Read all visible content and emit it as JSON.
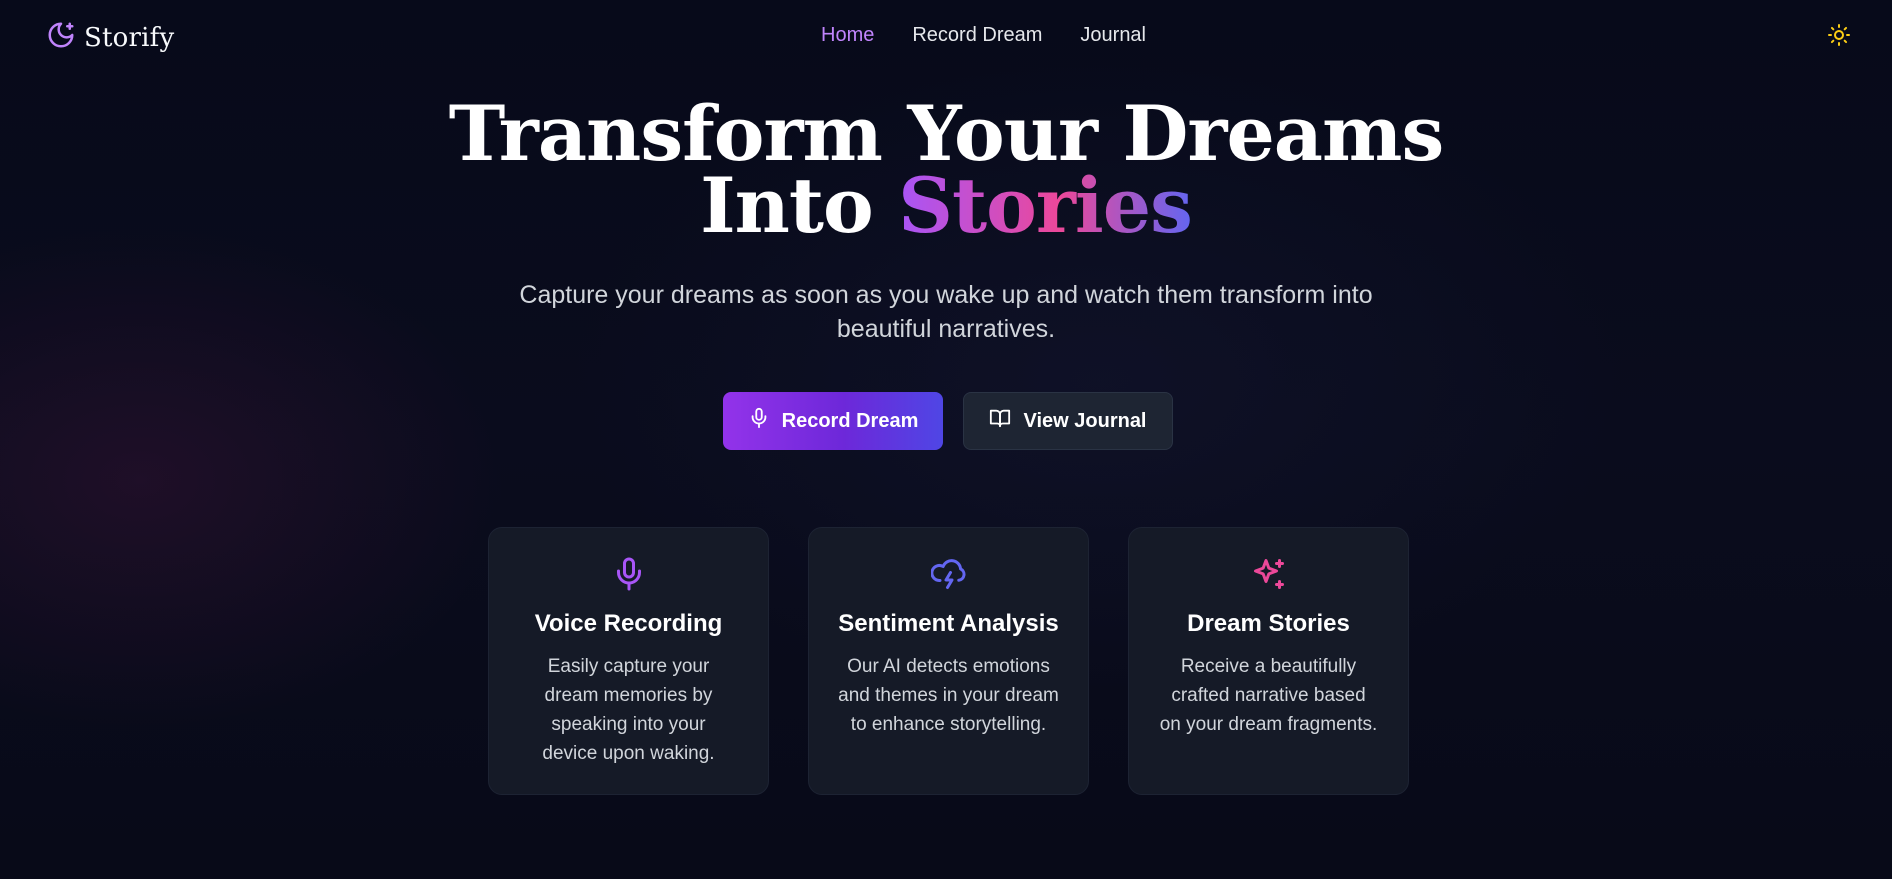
{
  "app": {
    "brand": "Storify",
    "accent": "#c084fc"
  },
  "nav": {
    "items": [
      {
        "label": "Home",
        "active": true
      },
      {
        "label": "Record Dream",
        "active": false
      },
      {
        "label": "Journal",
        "active": false
      }
    ],
    "theme_toggle_icon": "sun-icon"
  },
  "hero": {
    "title_line1": "Transform Your Dreams",
    "title_line2_plain": "Into",
    "title_line2_accent": "Stories",
    "subtitle": "Capture your dreams as soon as you wake up and watch them transform into beautiful narratives.",
    "primary_cta": {
      "label": "Record Dream",
      "icon": "microphone-icon"
    },
    "secondary_cta": {
      "label": "View Journal",
      "icon": "book-open-icon"
    }
  },
  "features": [
    {
      "icon": "microphone-icon",
      "icon_color": "#a855f7",
      "title": "Voice Recording",
      "description": "Easily capture your dream memories by speaking into your device upon waking."
    },
    {
      "icon": "cloud-lightning-icon",
      "icon_color": "#6366f1",
      "title": "Sentiment Analysis",
      "description": "Our AI detects emotions and themes in your dream to enhance storytelling."
    },
    {
      "icon": "sparkles-icon",
      "icon_color": "#ec4899",
      "title": "Dream Stories",
      "description": "Receive a beautifully crafted narrative based on your dream fragments."
    }
  ]
}
